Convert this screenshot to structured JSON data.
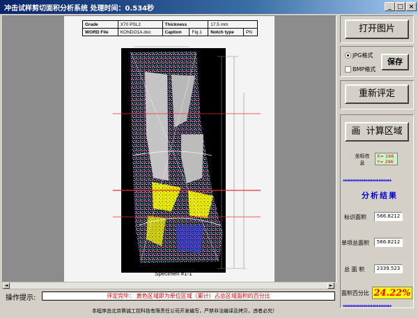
{
  "window": {
    "title": "冲击试样剪切面积分析系统   处理时间：0.534秒",
    "min_label": "_",
    "max_label": "□",
    "close_label": "×"
  },
  "document": {
    "table": [
      [
        "Grade",
        "X70 PSL2",
        "Thickness",
        "17.5 mm"
      ],
      [
        "WORD File",
        "KONDO1A.doc",
        "Caption",
        "Fig.1",
        "Notch type",
        "PN"
      ]
    ],
    "caption": "Specimen #1-1"
  },
  "scrollbar": {
    "left": "◄",
    "right": "►"
  },
  "toolbar": {
    "open_image": "打开图片",
    "format_jpg": "JPG格式",
    "format_bmp": "BMP格式",
    "save": "保存",
    "reevaluate": "重新评定",
    "draw": "画",
    "calc_area": "计算区域"
  },
  "coords": {
    "label": "坐标信息",
    "x": "X= 166",
    "y": "Y= 296"
  },
  "results": {
    "stars": "**************************",
    "title": "分析结果",
    "unit_area_label": "标识面积",
    "unit_area_value": "566.8212",
    "total_item_label": "单项总面积",
    "total_item_value": "566.8212",
    "total_area_label": "总 面 积",
    "total_area_value": "2339.523",
    "percent_label": "面积百分比",
    "percent_value": "24.22%"
  },
  "status": {
    "hint_label": "操作提示:",
    "hint_text": "评定完毕：  黄色区域即为单位区域（累计）占总区域面积的百分比"
  },
  "footer": "本程序由北京赛诚工控科技有限责任公司开发编写，严禁非法编译及拷贝，违者必究！",
  "colors": {
    "title_bar": "#0a246a",
    "hint_text": "#e00000",
    "percent_bg": "#ffff00",
    "percent_fg": "#ff0000",
    "coord_bg": "#c9f5c9",
    "stars": "#0000ee"
  }
}
